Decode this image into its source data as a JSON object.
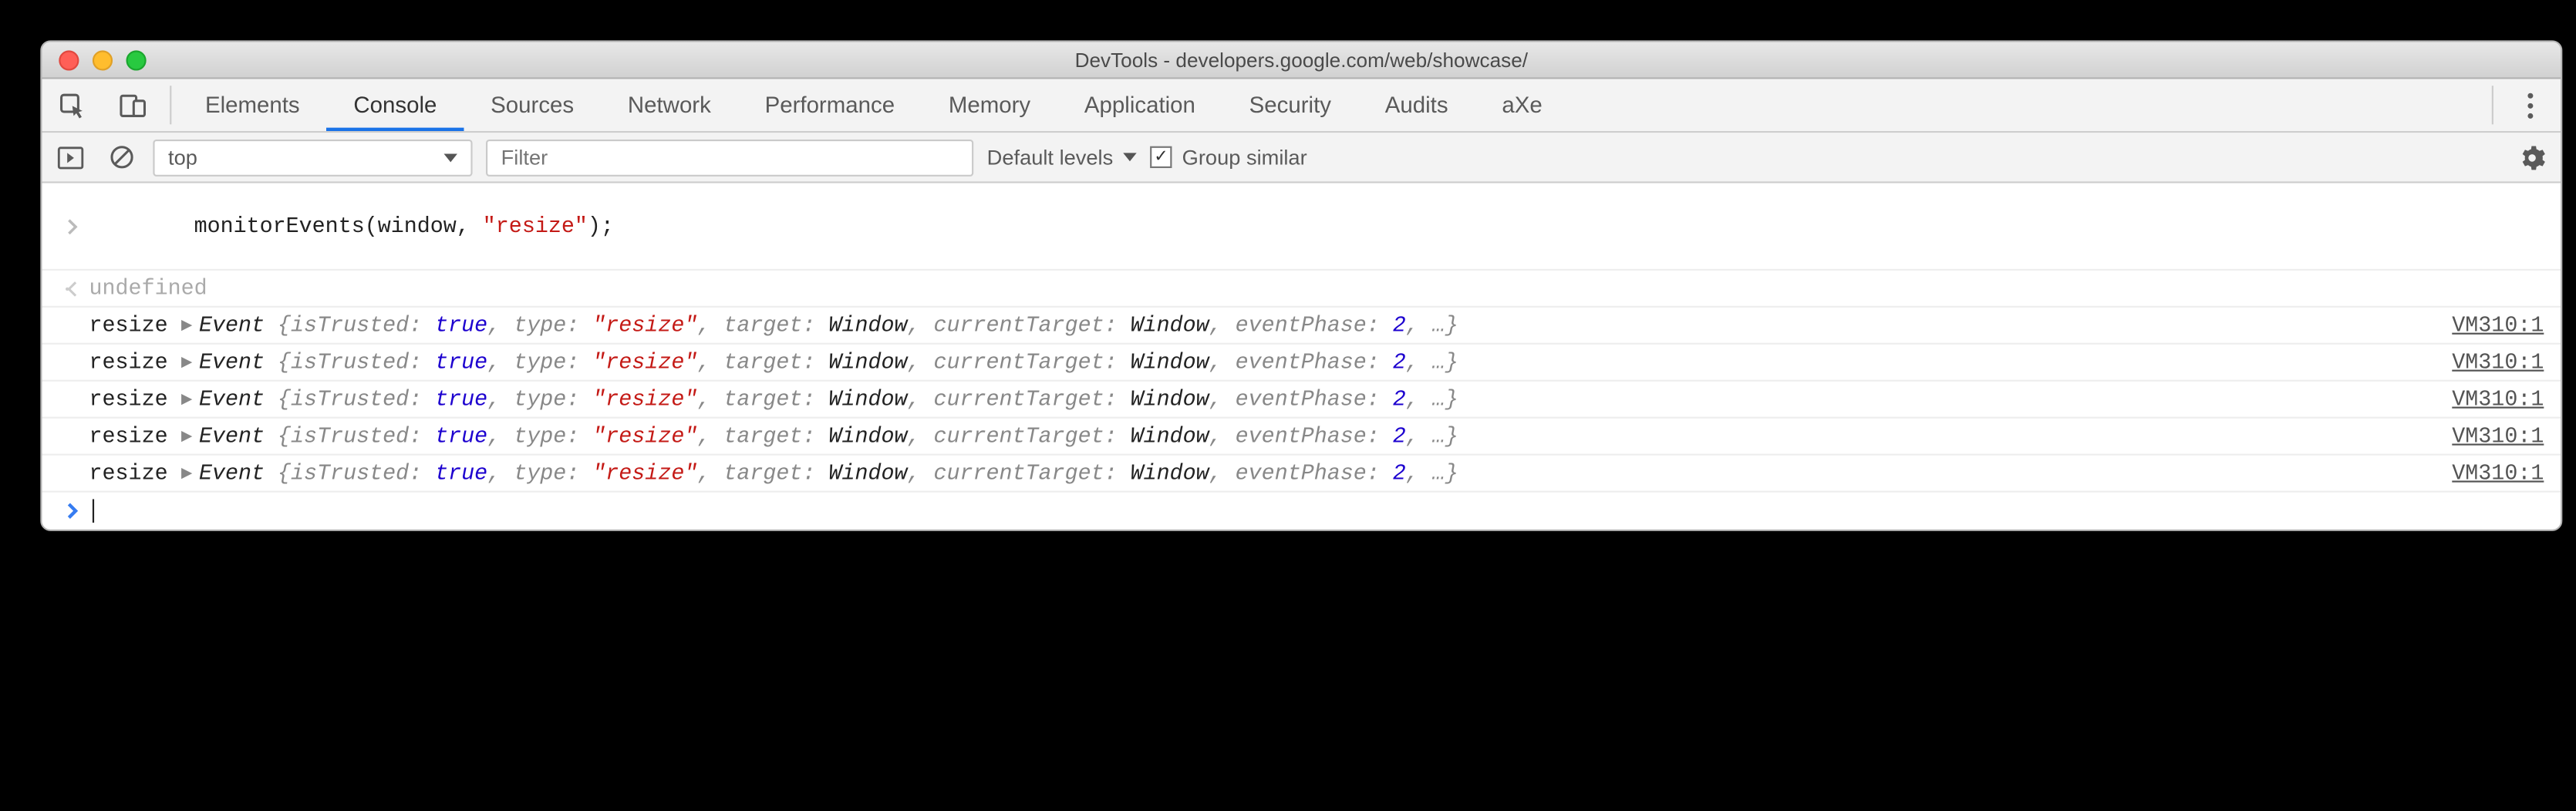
{
  "window": {
    "title": "DevTools - developers.google.com/web/showcase/"
  },
  "tabs": {
    "items": [
      "Elements",
      "Console",
      "Sources",
      "Network",
      "Performance",
      "Memory",
      "Application",
      "Security",
      "Audits",
      "aXe"
    ],
    "active": "Console"
  },
  "consolebar": {
    "context": "top",
    "filter_placeholder": "Filter",
    "levels_label": "Default levels",
    "group_similar_label": "Group similar",
    "group_similar_checked": true
  },
  "input": {
    "code_pre": "monitorEvents(window, ",
    "code_str": "\"resize\"",
    "code_post": ");"
  },
  "result": {
    "text": "undefined"
  },
  "event_rows": [
    {
      "name": "resize",
      "cls": "Event",
      "props": {
        "isTrusted": "true",
        "type": "\"resize\"",
        "target": "Window",
        "currentTarget": "Window",
        "eventPhase": "2"
      },
      "source": "VM310:1"
    },
    {
      "name": "resize",
      "cls": "Event",
      "props": {
        "isTrusted": "true",
        "type": "\"resize\"",
        "target": "Window",
        "currentTarget": "Window",
        "eventPhase": "2"
      },
      "source": "VM310:1"
    },
    {
      "name": "resize",
      "cls": "Event",
      "props": {
        "isTrusted": "true",
        "type": "\"resize\"",
        "target": "Window",
        "currentTarget": "Window",
        "eventPhase": "2"
      },
      "source": "VM310:1"
    },
    {
      "name": "resize",
      "cls": "Event",
      "props": {
        "isTrusted": "true",
        "type": "\"resize\"",
        "target": "Window",
        "currentTarget": "Window",
        "eventPhase": "2"
      },
      "source": "VM310:1"
    },
    {
      "name": "resize",
      "cls": "Event",
      "props": {
        "isTrusted": "true",
        "type": "\"resize\"",
        "target": "Window",
        "currentTarget": "Window",
        "eventPhase": "2"
      },
      "source": "VM310:1"
    }
  ]
}
